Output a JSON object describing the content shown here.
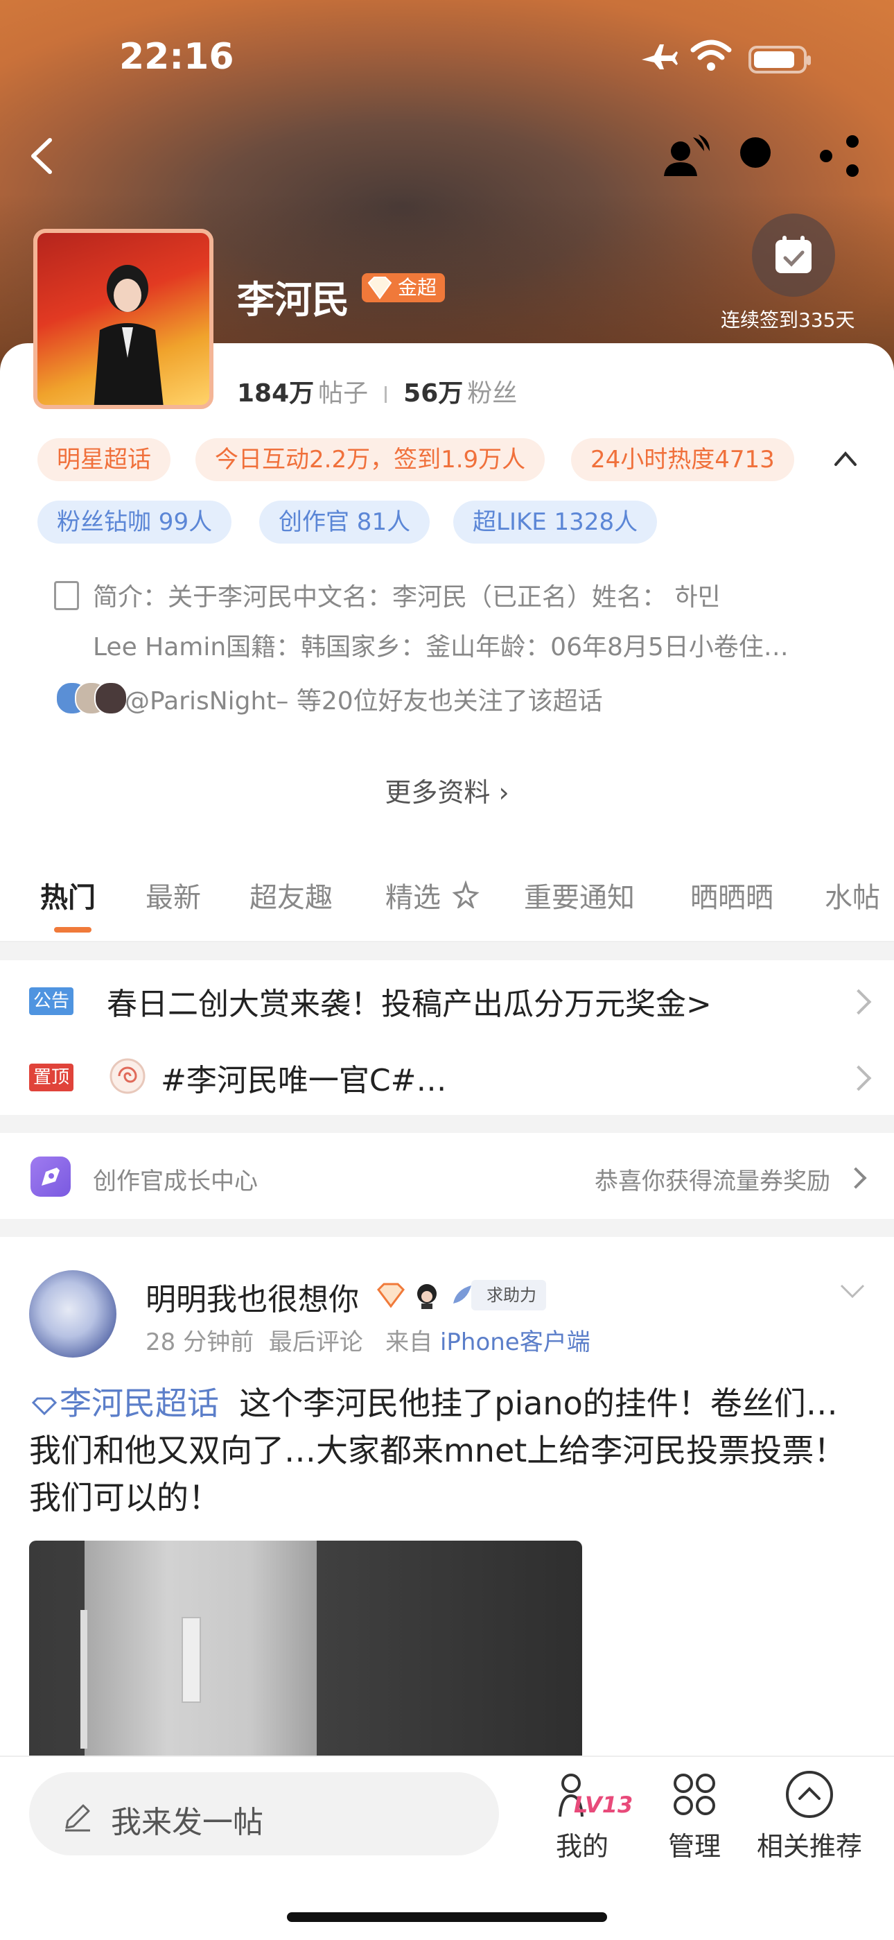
{
  "status_bar": {
    "time": "22:16"
  },
  "header": {
    "title": "李河民",
    "badge": "金超",
    "checkin_label": "连续签到335天",
    "posts_count": "184万",
    "posts_label": "帖子",
    "fans_count": "56万",
    "fans_label": "粉丝"
  },
  "chips_row1": [
    "明星超话",
    "今日互动2.2万，签到1.9万人",
    "24小时热度4713"
  ],
  "chips_row2": [
    "粉丝钻咖 99人",
    "创作官 81人",
    "超LIKE 1328人"
  ],
  "intro": {
    "line1": "简介：关于李河民中文名：李河民（已正名）姓名： 하민",
    "line2": "Lee Hamin国籍：韩国家乡：釜山年龄：06年8月5日小卷住…"
  },
  "friends_text": "@ParisNight– 等20位好友也关注了该超话",
  "more_label": "更多资料",
  "tabs": [
    "热门",
    "最新",
    "超友趣",
    "精选",
    "重要通知",
    "晒晒晒",
    "水帖"
  ],
  "pinned": [
    {
      "tag": "公告",
      "text": "春日二创大赏来袭！投稿产出瓜分万元奖金>"
    },
    {
      "tag": "置顶",
      "text": "#李河民唯一官C#…"
    }
  ],
  "creator": {
    "label": "创作官成长中心",
    "reward": "恭喜你获得流量券奖励"
  },
  "post": {
    "author": "明明我也很想你",
    "help_tag": "求助力",
    "time": "28 分钟前",
    "last_comment": "最后评论",
    "from": "来自",
    "source": "iPhone客户端",
    "topic": "李河民超话",
    "body": "这个李河民他挂了piano的挂件！卷丝们…我们和他又双向了…大家都来mnet上给李河民投票投票！我们可以的！"
  },
  "bottom_bar": {
    "compose_placeholder": "我来发一帖",
    "level": "LV13",
    "nav": [
      "我的",
      "管理",
      "相关推荐"
    ]
  },
  "colors": {
    "accent": "#f07a3a",
    "link": "#5b7ec9"
  }
}
